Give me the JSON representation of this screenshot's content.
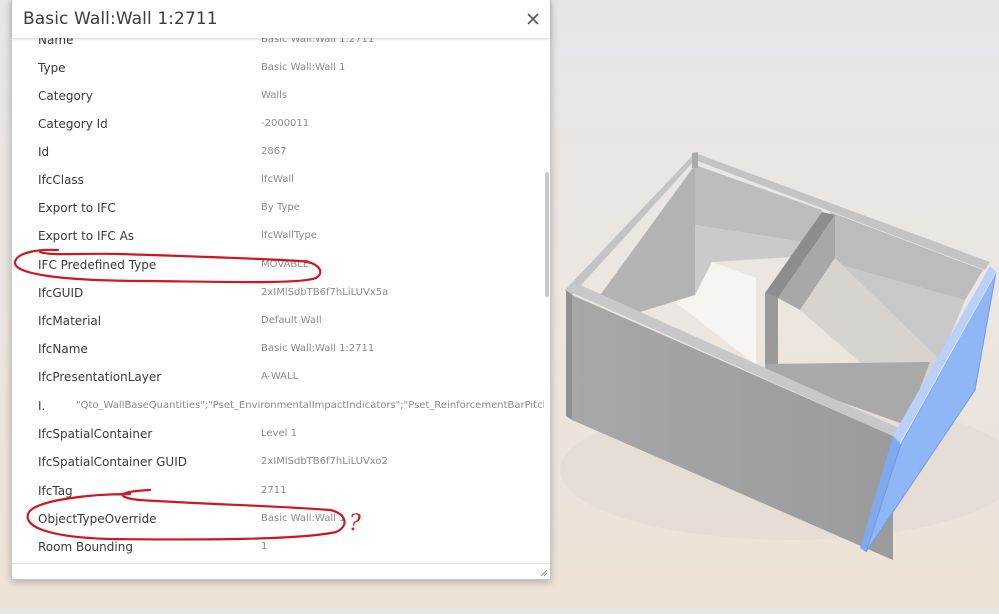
{
  "panel": {
    "title": "Basic Wall:Wall 1:2711",
    "rows": [
      {
        "name": "Name",
        "value": "Basic Wall:Wall 1:2711"
      },
      {
        "name": "Type",
        "value": "Basic Wall:Wall 1"
      },
      {
        "name": "Category",
        "value": "Walls"
      },
      {
        "name": "Category Id",
        "value": "-2000011"
      },
      {
        "name": "Id",
        "value": "2867"
      },
      {
        "name": "IfcClass",
        "value": "IfcWall"
      },
      {
        "name": "Export to IFC",
        "value": "By Type"
      },
      {
        "name": "Export to IFC As",
        "value": "IfcWallType"
      },
      {
        "name": "IFC Predefined Type",
        "value": "MOVABLE"
      },
      {
        "name": "IfcGUID",
        "value": "2xIMlSdbTB6f7hLiLUVx5a"
      },
      {
        "name": "IfcMaterial",
        "value": "Default Wall"
      },
      {
        "name": "IfcName",
        "value": "Basic Wall:Wall 1:2711"
      },
      {
        "name": "IfcPresentationLayer",
        "value": "A-WALL"
      },
      {
        "name": "I.",
        "value": "\"Qto_WallBaseQuantities\";\"Pset_EnvironmentalImpactIndicators\";\"Pset_ReinforcementBarPitchOfWall\";\"P"
      },
      {
        "name": "IfcSpatialContainer",
        "value": "Level 1"
      },
      {
        "name": "IfcSpatialContainer GUID",
        "value": "2xIMlSdbTB6f7hLiLUVxo2"
      },
      {
        "name": "IfcTag",
        "value": "2711"
      },
      {
        "name": "ObjectTypeOverride",
        "value": "Basic Wall:Wall 1"
      },
      {
        "name": "Room Bounding",
        "value": "1"
      }
    ]
  },
  "annotation": {
    "mark": "?"
  },
  "colors": {
    "annotation": "#d0161e",
    "selection": "#8fb6f6",
    "wall": "#a3a3a3"
  }
}
